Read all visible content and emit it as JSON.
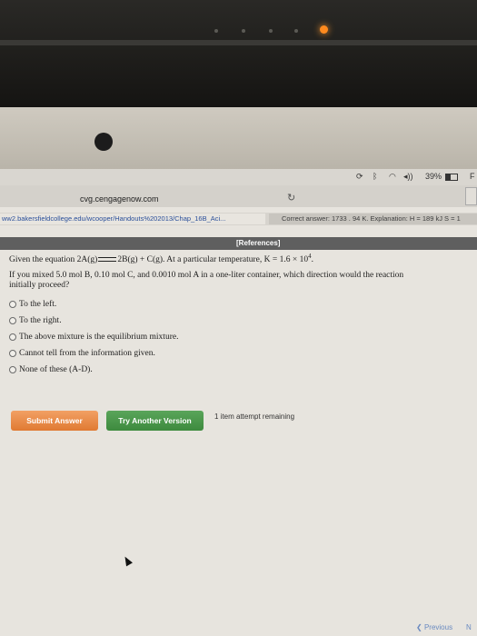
{
  "status_bar": {
    "battery": "39%",
    "carrier_right": "F"
  },
  "browser": {
    "url": "cvg.cengagenow.com",
    "tab_link": "ww2.bakersfieldcollege.edu/wcooper/Handouts%202013/Chap_16B_Aci...",
    "tab_answer": "Correct answer: 1733 . 94 K. Explanation: H = 189 kJ S = 1"
  },
  "references_label": "[References]",
  "question": {
    "given_prefix": "Given the equation 2A(g)",
    "given_suffix": "2B(g) + C(g). At a particular temperature, K = 1.6 × 10",
    "exponent": "4",
    "period": ".",
    "line2": "If you mixed 5.0 mol B, 0.10 mol C, and 0.0010 mol A in a one-liter container, which direction would the reaction",
    "line3": "initially proceed?"
  },
  "options": [
    "To the left.",
    "To the right.",
    "The above mixture is the equilibrium mixture.",
    "Cannot tell from the information given.",
    "None of these (A-D)."
  ],
  "buttons": {
    "submit": "Submit Answer",
    "try_another": "Try Another Version",
    "attempts": "1 item attempt remaining"
  },
  "nav": {
    "previous": "Previous",
    "next": "N"
  },
  "colors": {
    "submit": "#e88a48",
    "try_another": "#4a9a4b",
    "references_bar": "#5f5f5f"
  }
}
